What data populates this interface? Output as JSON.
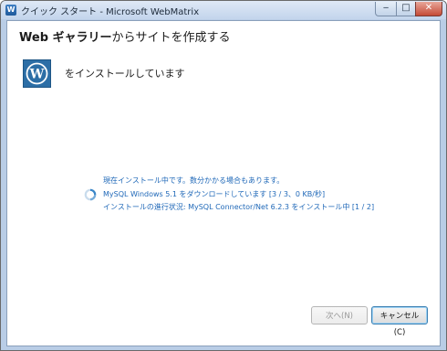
{
  "window": {
    "title": "クイック スタート - Microsoft WebMatrix",
    "app_icon": "webmatrix-icon",
    "controls": {
      "minimize": "‒",
      "maximize": "□",
      "close": "✕"
    }
  },
  "header": {
    "title_bold": "Web ギャラリー",
    "title_rest": "からサイトを作成する"
  },
  "install": {
    "logo_icon": "wordpress-icon",
    "status_text": "をインストールしています",
    "progress_lines": [
      "現在インストール中です。数分かかる場合もあります。",
      "MySQL Windows 5.1 をダウンロードしています [3 / 3、0 KB/秒]",
      "インストールの進行状況: MySQL Connector/Net 6.2.3 をインストール中 [1 / 2]"
    ],
    "spinner_icon": "loading-spinner-icon"
  },
  "buttons": {
    "next": "次へ(N)",
    "cancel": "キャンセル(C)"
  },
  "colors": {
    "progress_text": "#1f68b8",
    "wordpress_logo_bg": "#2c6ea6",
    "window_frame": "#b9cde6"
  }
}
